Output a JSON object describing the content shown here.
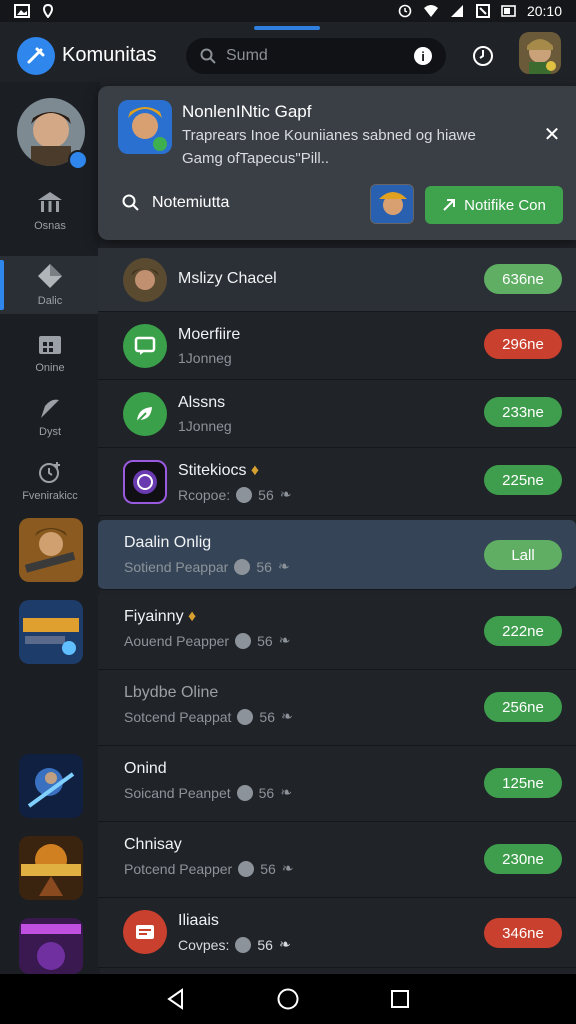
{
  "status_bar": {
    "time": "20:10"
  },
  "header": {
    "app_title": "Komunitas",
    "search_placeholder": "Sumd",
    "info_label": "i"
  },
  "rail": {
    "items": [
      {
        "label": "Osnas",
        "icon": "building-icon",
        "active": false
      },
      {
        "label": "Dalic",
        "icon": "diamond-icon",
        "active": true
      },
      {
        "label": "Onine",
        "icon": "calendar-icon",
        "active": false
      },
      {
        "label": "Dyst",
        "icon": "feather-icon",
        "active": false
      },
      {
        "label": "Fvenirakicc",
        "icon": "clock-add-icon",
        "active": false
      }
    ]
  },
  "notification": {
    "title": "NonlenINtic Gapf",
    "text": "Traprears Inoe Kouniianes sabned og hiawe Gamg ofTapecus\"Pill..",
    "search_label": "Notemiutta",
    "button_label": "Notifike Con"
  },
  "list": [
    {
      "title": "Mslizy Chacel",
      "sub": "",
      "pill": "636ne",
      "pill_color": "lgreen",
      "icon": "avatar"
    },
    {
      "title": "Moerfiire",
      "sub": "1Jonneg",
      "pill": "296ne",
      "pill_color": "red",
      "icon": "chat-icon"
    },
    {
      "title": "Alssns",
      "sub": "1Jonneg",
      "pill": "233ne",
      "pill_color": "green",
      "icon": "leaf-icon"
    },
    {
      "title": "Stitekiocs",
      "sub": "Rcopoe:",
      "sub_extra": "56",
      "pill": "225ne",
      "pill_color": "green",
      "icon": "target-icon"
    },
    {
      "title": "Daalin Onlig",
      "sub": "Sotiend Peappar",
      "sub_extra": "56",
      "pill": "Lall",
      "pill_color": "lgreen",
      "icon": "none",
      "highlight": true
    },
    {
      "title": "Fiyainny",
      "sub": "Aouend Peapper",
      "sub_extra": "56",
      "pill": "222ne",
      "pill_color": "green",
      "icon": "none"
    },
    {
      "title": "Lbydbe Oline",
      "sub": "Sotcend Peappat",
      "sub_extra": "56",
      "pill": "256ne",
      "pill_color": "green",
      "icon": "none"
    },
    {
      "title": "Onind",
      "sub": "Soicand Peanpet",
      "sub_extra": "56",
      "pill": "125ne",
      "pill_color": "green",
      "icon": "none"
    },
    {
      "title": "Chnisay",
      "sub": "Potcend Peapper",
      "sub_extra": "56",
      "pill": "230ne",
      "pill_color": "green",
      "icon": "none"
    },
    {
      "title": "Iliaais",
      "sub": "Covpes:",
      "sub_extra": "56",
      "pill": "346ne",
      "pill_color": "red",
      "icon": "card-icon"
    }
  ]
}
